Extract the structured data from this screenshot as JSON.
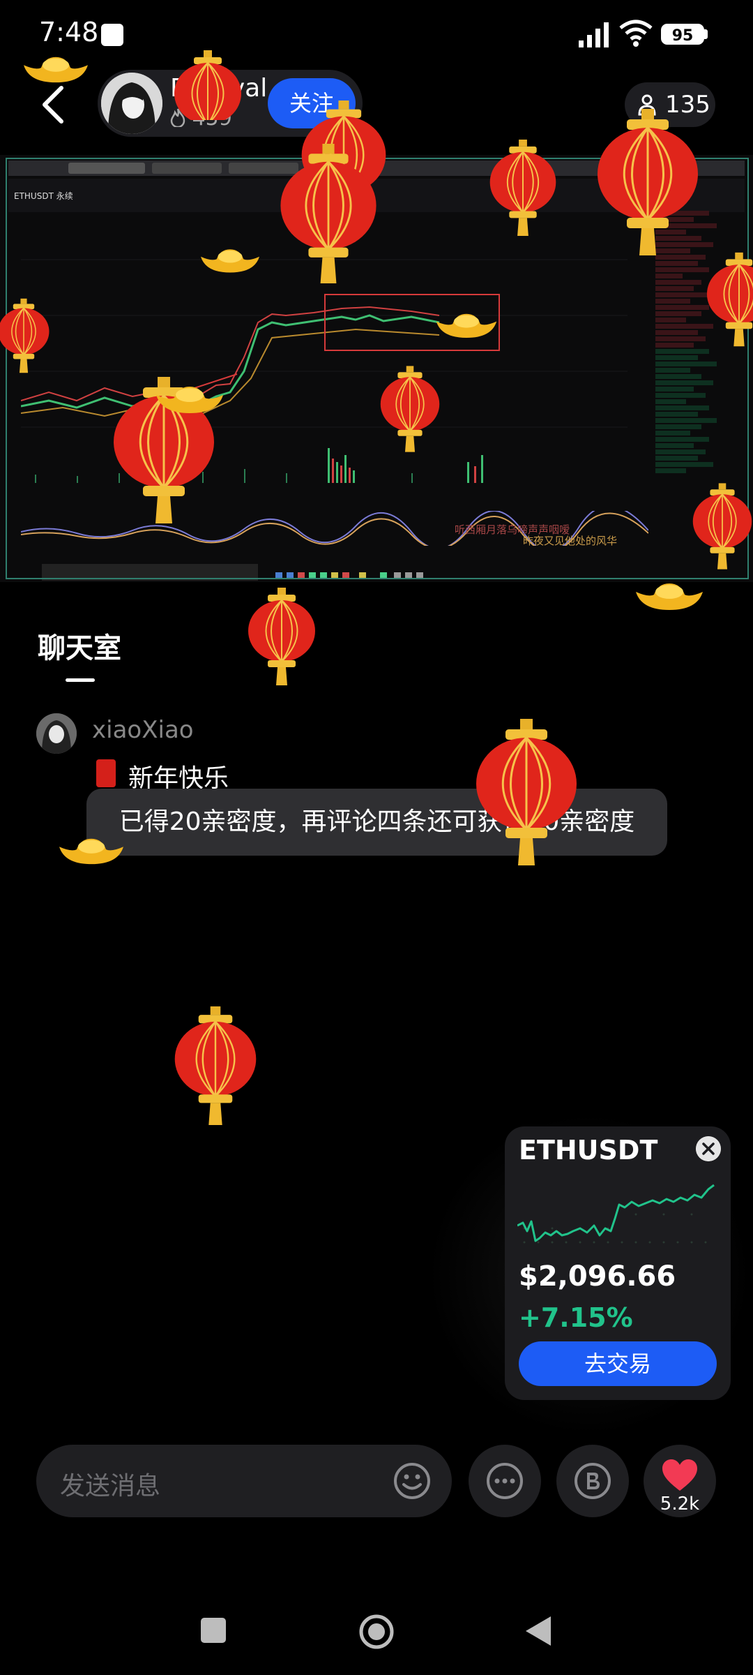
{
  "status_bar": {
    "time": "7:48",
    "battery": "95"
  },
  "header": {
    "host_name": "Parzival",
    "host_heat": "459",
    "follow_label": "关注",
    "viewer_count": "135"
  },
  "stream": {
    "symbol": "ETHUSDT 永续",
    "overlay_line1": "听西厢月落乌啼声声咽嗳",
    "overlay_line2": "昨夜又见他处的风华"
  },
  "chat": {
    "title": "聊天室",
    "messages": [
      {
        "user": "xiaoXiao",
        "text": "新年快乐"
      }
    ],
    "toast": "已得20亲密度，再评论四条还可获得80亲密度"
  },
  "ticker_card": {
    "symbol": "ETHUSDT",
    "price": "$2,096.66",
    "change": "+7.15%",
    "trade_label": "去交易",
    "change_color": "#21c38b"
  },
  "input_bar": {
    "placeholder": "发送消息",
    "like_count": "5.2k"
  },
  "colors": {
    "accent_blue": "#1d5cf5",
    "lantern_red": "#e0251b",
    "gold": "#f2b51f"
  }
}
